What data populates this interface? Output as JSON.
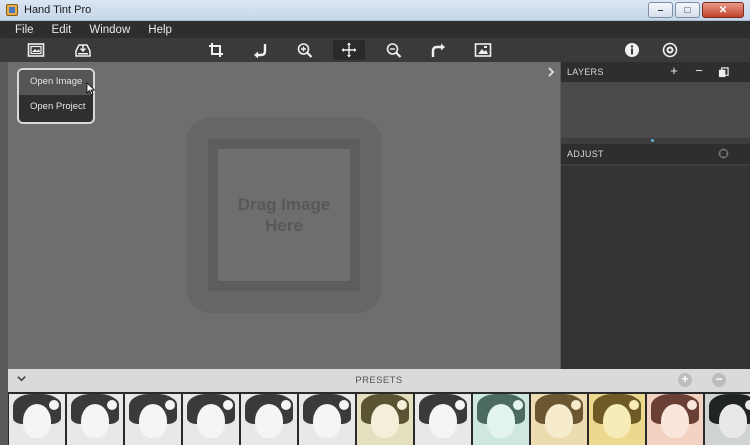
{
  "window": {
    "title": "Hand Tint Pro"
  },
  "menubar": {
    "items": [
      "File",
      "Edit",
      "Window",
      "Help"
    ]
  },
  "toolbar": {
    "tools": [
      "open-image-icon",
      "save-icon",
      "crop-icon",
      "rotate-left-icon",
      "zoom-in-icon",
      "move-icon",
      "zoom-out-icon",
      "rotate-right-icon",
      "fit-image-icon",
      "info-icon",
      "settings-icon"
    ]
  },
  "dropdown": {
    "items": [
      "Open Image",
      "Open Project"
    ]
  },
  "canvas": {
    "placeholder": "Drag Image Here"
  },
  "panels": {
    "layers": {
      "title": "LAYERS"
    },
    "adjust": {
      "title": "ADJUST"
    }
  },
  "presets": {
    "label": "PRESETS",
    "thumbnails": [
      {
        "tint": "bw"
      },
      {
        "tint": "bw"
      },
      {
        "tint": "bw"
      },
      {
        "tint": "bw"
      },
      {
        "tint": "bw"
      },
      {
        "tint": "bw"
      },
      {
        "tint": "olive"
      },
      {
        "tint": "bw"
      },
      {
        "tint": "cyan"
      },
      {
        "tint": "sepia"
      },
      {
        "tint": "gold"
      },
      {
        "tint": "rose"
      },
      {
        "tint": "dark"
      }
    ],
    "tint_colors": {
      "bw": [
        "#e8e8e8",
        "#3a3a3a",
        "#f5f5f5"
      ],
      "olive": [
        "#e4e0bf",
        "#5a5434",
        "#f3efd8"
      ],
      "cyan": [
        "#cfe8df",
        "#4a6a62",
        "#e3f3ee"
      ],
      "sepia": [
        "#ecdcb0",
        "#6a5630",
        "#f6ebcc"
      ],
      "gold": [
        "#ecd98f",
        "#6e5a24",
        "#f7ecb8"
      ],
      "rose": [
        "#f3d2c2",
        "#6a4034",
        "#fbe6dc"
      ],
      "dark": [
        "#d0d4d0",
        "#202422",
        "#e8e8e8"
      ]
    }
  }
}
